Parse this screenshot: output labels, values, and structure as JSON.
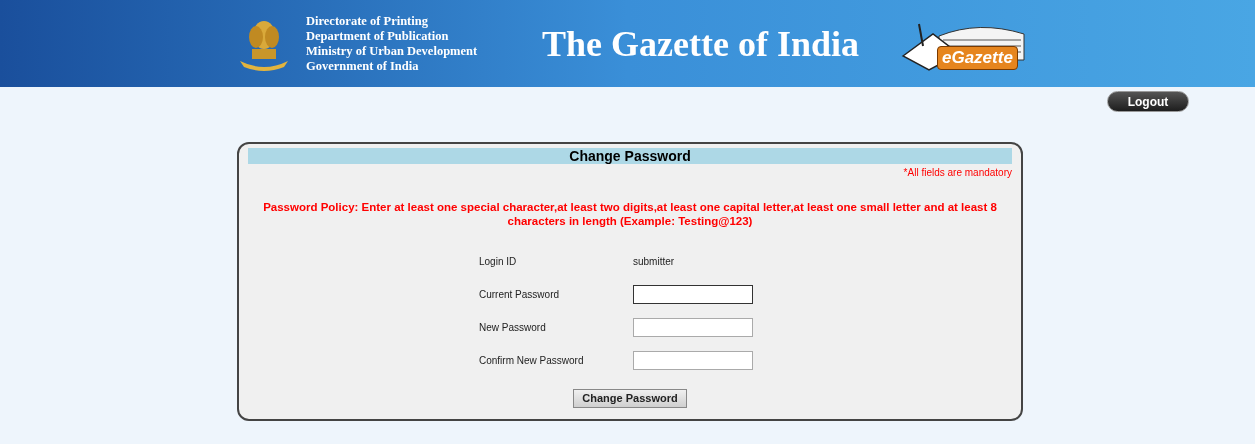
{
  "header": {
    "org_lines": [
      "Directorate of Printing",
      "Department of Publication",
      "Ministry of Urban Development",
      "Government of India"
    ],
    "title": "The Gazette of India",
    "logo_text": "eGazette"
  },
  "logout_button": "Logout",
  "panel": {
    "title": "Change Password",
    "mandatory_note": "*All fields are mandatory",
    "policy": "Password Policy: Enter at least one special character,at least two digits,at least one capital letter,at least one small letter and at least 8 characters in length (Example: Testing@123)",
    "fields": [
      {
        "kind": "text",
        "label": "Login ID",
        "value": "submitter"
      },
      {
        "kind": "input",
        "label": "Current Password",
        "focused": true
      },
      {
        "kind": "input",
        "label": "New Password",
        "focused": false
      },
      {
        "kind": "input",
        "label": "Confirm New Password",
        "focused": false
      }
    ],
    "submit_button": "Change Password"
  }
}
